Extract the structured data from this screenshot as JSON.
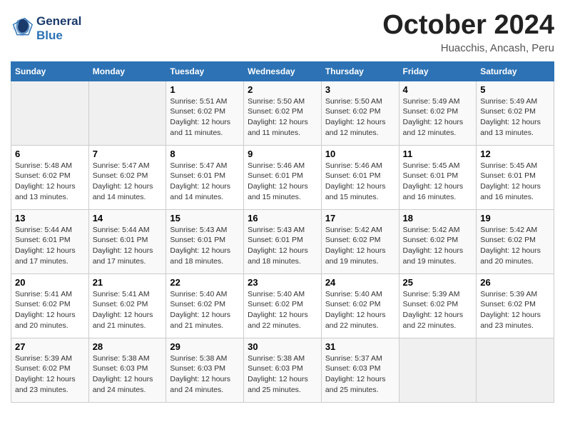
{
  "header": {
    "logo": {
      "line1": "General",
      "line2": "Blue"
    },
    "title": "October 2024",
    "subtitle": "Huacchis, Ancash, Peru"
  },
  "weekdays": [
    "Sunday",
    "Monday",
    "Tuesday",
    "Wednesday",
    "Thursday",
    "Friday",
    "Saturday"
  ],
  "weeks": [
    [
      {
        "day": "",
        "info": ""
      },
      {
        "day": "",
        "info": ""
      },
      {
        "day": "1",
        "info": "Sunrise: 5:51 AM\nSunset: 6:02 PM\nDaylight: 12 hours\nand 11 minutes."
      },
      {
        "day": "2",
        "info": "Sunrise: 5:50 AM\nSunset: 6:02 PM\nDaylight: 12 hours\nand 11 minutes."
      },
      {
        "day": "3",
        "info": "Sunrise: 5:50 AM\nSunset: 6:02 PM\nDaylight: 12 hours\nand 12 minutes."
      },
      {
        "day": "4",
        "info": "Sunrise: 5:49 AM\nSunset: 6:02 PM\nDaylight: 12 hours\nand 12 minutes."
      },
      {
        "day": "5",
        "info": "Sunrise: 5:49 AM\nSunset: 6:02 PM\nDaylight: 12 hours\nand 13 minutes."
      }
    ],
    [
      {
        "day": "6",
        "info": "Sunrise: 5:48 AM\nSunset: 6:02 PM\nDaylight: 12 hours\nand 13 minutes."
      },
      {
        "day": "7",
        "info": "Sunrise: 5:47 AM\nSunset: 6:02 PM\nDaylight: 12 hours\nand 14 minutes."
      },
      {
        "day": "8",
        "info": "Sunrise: 5:47 AM\nSunset: 6:01 PM\nDaylight: 12 hours\nand 14 minutes."
      },
      {
        "day": "9",
        "info": "Sunrise: 5:46 AM\nSunset: 6:01 PM\nDaylight: 12 hours\nand 15 minutes."
      },
      {
        "day": "10",
        "info": "Sunrise: 5:46 AM\nSunset: 6:01 PM\nDaylight: 12 hours\nand 15 minutes."
      },
      {
        "day": "11",
        "info": "Sunrise: 5:45 AM\nSunset: 6:01 PM\nDaylight: 12 hours\nand 16 minutes."
      },
      {
        "day": "12",
        "info": "Sunrise: 5:45 AM\nSunset: 6:01 PM\nDaylight: 12 hours\nand 16 minutes."
      }
    ],
    [
      {
        "day": "13",
        "info": "Sunrise: 5:44 AM\nSunset: 6:01 PM\nDaylight: 12 hours\nand 17 minutes."
      },
      {
        "day": "14",
        "info": "Sunrise: 5:44 AM\nSunset: 6:01 PM\nDaylight: 12 hours\nand 17 minutes."
      },
      {
        "day": "15",
        "info": "Sunrise: 5:43 AM\nSunset: 6:01 PM\nDaylight: 12 hours\nand 18 minutes."
      },
      {
        "day": "16",
        "info": "Sunrise: 5:43 AM\nSunset: 6:01 PM\nDaylight: 12 hours\nand 18 minutes."
      },
      {
        "day": "17",
        "info": "Sunrise: 5:42 AM\nSunset: 6:02 PM\nDaylight: 12 hours\nand 19 minutes."
      },
      {
        "day": "18",
        "info": "Sunrise: 5:42 AM\nSunset: 6:02 PM\nDaylight: 12 hours\nand 19 minutes."
      },
      {
        "day": "19",
        "info": "Sunrise: 5:42 AM\nSunset: 6:02 PM\nDaylight: 12 hours\nand 20 minutes."
      }
    ],
    [
      {
        "day": "20",
        "info": "Sunrise: 5:41 AM\nSunset: 6:02 PM\nDaylight: 12 hours\nand 20 minutes."
      },
      {
        "day": "21",
        "info": "Sunrise: 5:41 AM\nSunset: 6:02 PM\nDaylight: 12 hours\nand 21 minutes."
      },
      {
        "day": "22",
        "info": "Sunrise: 5:40 AM\nSunset: 6:02 PM\nDaylight: 12 hours\nand 21 minutes."
      },
      {
        "day": "23",
        "info": "Sunrise: 5:40 AM\nSunset: 6:02 PM\nDaylight: 12 hours\nand 22 minutes."
      },
      {
        "day": "24",
        "info": "Sunrise: 5:40 AM\nSunset: 6:02 PM\nDaylight: 12 hours\nand 22 minutes."
      },
      {
        "day": "25",
        "info": "Sunrise: 5:39 AM\nSunset: 6:02 PM\nDaylight: 12 hours\nand 22 minutes."
      },
      {
        "day": "26",
        "info": "Sunrise: 5:39 AM\nSunset: 6:02 PM\nDaylight: 12 hours\nand 23 minutes."
      }
    ],
    [
      {
        "day": "27",
        "info": "Sunrise: 5:39 AM\nSunset: 6:02 PM\nDaylight: 12 hours\nand 23 minutes."
      },
      {
        "day": "28",
        "info": "Sunrise: 5:38 AM\nSunset: 6:03 PM\nDaylight: 12 hours\nand 24 minutes."
      },
      {
        "day": "29",
        "info": "Sunrise: 5:38 AM\nSunset: 6:03 PM\nDaylight: 12 hours\nand 24 minutes."
      },
      {
        "day": "30",
        "info": "Sunrise: 5:38 AM\nSunset: 6:03 PM\nDaylight: 12 hours\nand 25 minutes."
      },
      {
        "day": "31",
        "info": "Sunrise: 5:37 AM\nSunset: 6:03 PM\nDaylight: 12 hours\nand 25 minutes."
      },
      {
        "day": "",
        "info": ""
      },
      {
        "day": "",
        "info": ""
      }
    ]
  ]
}
